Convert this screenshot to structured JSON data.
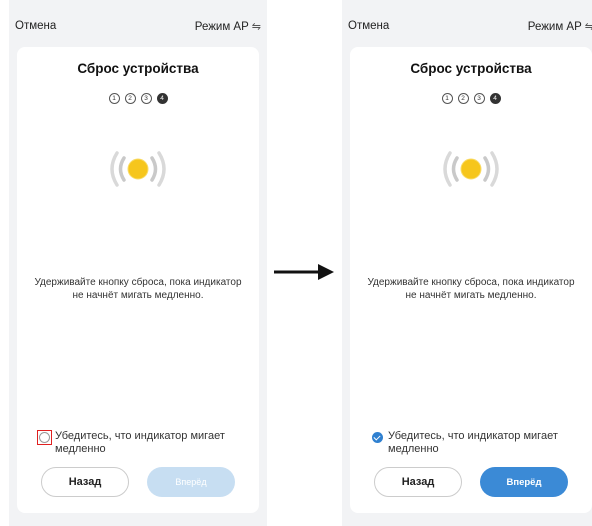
{
  "left_screen": {
    "cancel": "Отмена",
    "mode": "Режим AP",
    "mode_icon": "swap-icon",
    "title": "Сброс устройства",
    "steps": [
      "1",
      "2",
      "3",
      "4"
    ],
    "active_step": 4,
    "instruction": "Удерживайте кнопку сброса, пока индикатор не начнёт мигать медленно.",
    "confirm_text": "Убедитесь, что индикатор мигает медленно",
    "confirm_checked": false,
    "back_label": "Назад",
    "next_label": "Вперёд",
    "next_enabled": false
  },
  "right_screen": {
    "cancel": "Отмена",
    "mode": "Режим AP",
    "mode_icon": "swap-icon",
    "title": "Сброс устройства",
    "steps": [
      "1",
      "2",
      "3",
      "4"
    ],
    "active_step": 4,
    "instruction": "Удерживайте кнопку сброса, пока индикатор не начнёт мигать медленно.",
    "confirm_text": "Убедитесь, что индикатор мигает медленно",
    "confirm_checked": true,
    "back_label": "Назад",
    "next_label": "Вперёд",
    "next_enabled": true
  },
  "colors": {
    "accent": "#3b8ad6",
    "disabled": "#c7def2",
    "indicator": "#f6c61c",
    "highlight": "#e02020"
  }
}
